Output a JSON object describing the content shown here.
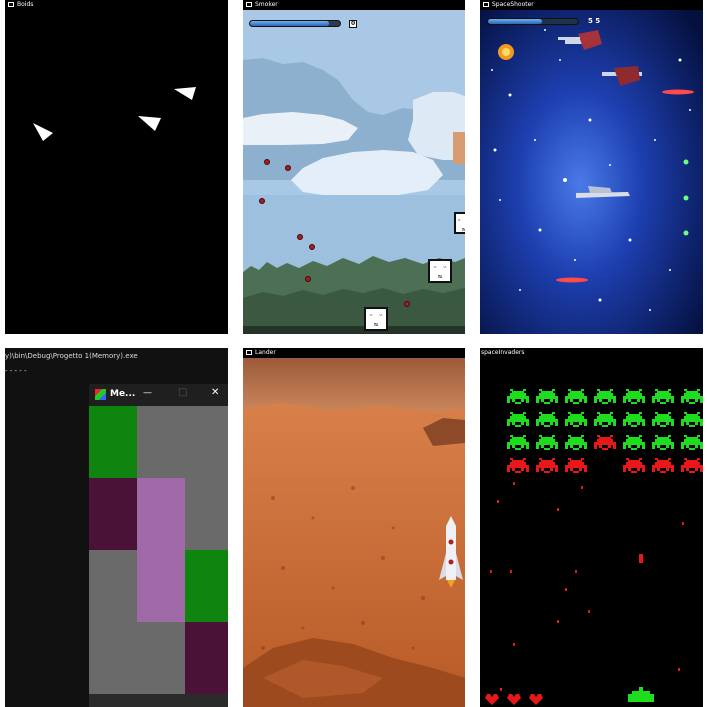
{
  "boids": {
    "title": "Boids",
    "colors": {
      "bg": "#000000",
      "boid": "#ffffff"
    },
    "boid_count": 3
  },
  "smoker": {
    "title": "Smoker",
    "health_fraction": 0.88,
    "score": "0",
    "enemy_face": "⌣\n⌇⌇⌇",
    "colors": {
      "sky": "#a9c8e6",
      "cloud": "#e9f0f8",
      "forest": "#3f6146",
      "ground": "#233327"
    }
  },
  "spaceshooter": {
    "title": "SpaceShooter",
    "health_fraction": 0.6,
    "score": "5 5"
  },
  "memory": {
    "path": "y)\\bin\\Debug\\Progetto 1(Memory).exe",
    "console_text": "- - - - -",
    "window_title": "Me...",
    "minimize_icon": "—",
    "maximize_icon": "□",
    "close_icon": "✕",
    "grid_colors": [
      [
        "#0f8510",
        "#6a6a6a",
        "#6a6a6a"
      ],
      [
        "#4a1236",
        "#a06aa8",
        "#6a6a6a"
      ],
      [
        "#6a6a6a",
        "#a06aa8",
        "#0f8510"
      ],
      [
        "#6a6a6a",
        "#6a6a6a",
        "#4a1236"
      ]
    ]
  },
  "lander": {
    "title": "Lander",
    "colors": {
      "sky": "#c07548",
      "sand": "#c9672f",
      "dark": "#8c3c16"
    }
  },
  "spaceinvaders": {
    "title": "spaceInvaders",
    "invader_rows": [
      [
        "green",
        "green",
        "green",
        "green",
        "green",
        "green",
        "green"
      ],
      [
        "green",
        "green",
        "green",
        "green",
        "green",
        "green",
        "green"
      ],
      [
        "green",
        "green",
        "green",
        "red",
        "green",
        "green",
        "green"
      ],
      [
        "red",
        "red",
        "red",
        "",
        "red",
        "red",
        "red"
      ]
    ],
    "lives": 3,
    "colors": {
      "green": "#1edc1e",
      "red": "#e81818",
      "player": "#1edc1e"
    }
  }
}
